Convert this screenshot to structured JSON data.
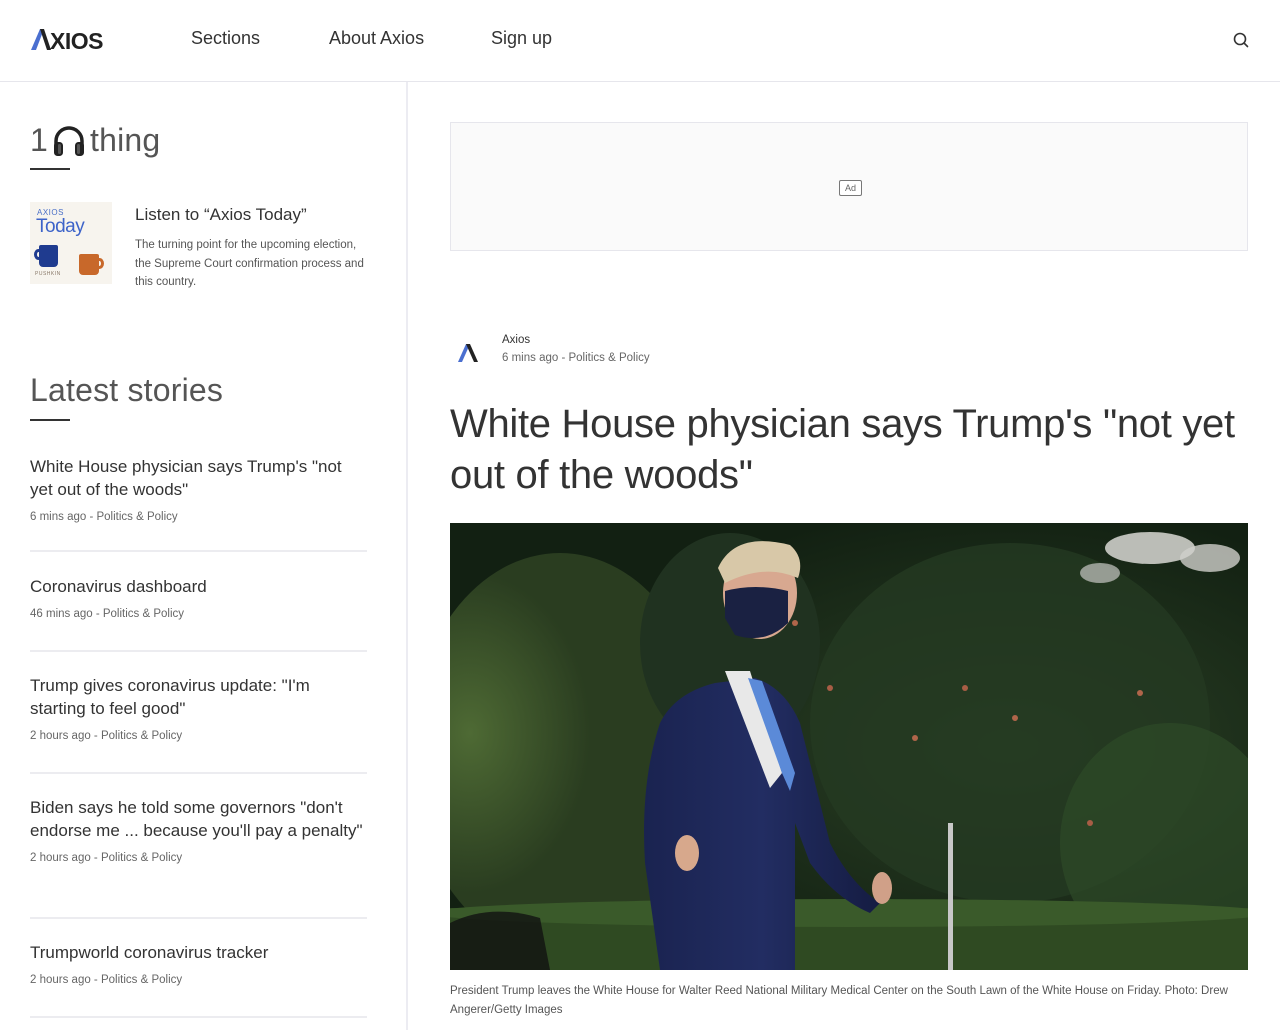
{
  "header": {
    "logo_text": "AXIOS",
    "nav": [
      {
        "label": "Sections"
      },
      {
        "label": "About Axios"
      },
      {
        "label": "Sign up"
      }
    ],
    "search_icon": "search-icon"
  },
  "sidebar": {
    "one_thing": {
      "title_prefix": "1",
      "title_icon": "headphones-icon",
      "title_suffix": "thing",
      "podcast": {
        "art_brand": "AXIOS",
        "art_title": "Today",
        "art_publisher": "PUSHKIN",
        "title": "Listen to “Axios Today”",
        "description": "The turning point for the upcoming election, the Supreme Court confirmation process and this country."
      }
    },
    "latest": {
      "title": "Latest stories",
      "stories": [
        {
          "title": "White House physician says Trump's \"not yet out of the woods\"",
          "meta": "6 mins ago - Politics & Policy"
        },
        {
          "title": "Coronavirus dashboard",
          "meta": "46 mins ago - Politics & Policy"
        },
        {
          "title": "Trump gives coronavirus update: \"I'm starting to feel good\"",
          "meta": "2 hours ago - Politics & Policy"
        },
        {
          "title": "Biden says he told some governors \"don't endorse me ... because you'll pay a penalty\"",
          "meta": "2 hours ago - Politics & Policy"
        },
        {
          "title": "Trumpworld coronavirus tracker",
          "meta": "2 hours ago - Politics & Policy"
        }
      ]
    }
  },
  "main": {
    "ad_label": "Ad",
    "article": {
      "author": "Axios",
      "meta": "6 mins ago - Politics & Policy",
      "headline": "White House physician says Trump's \"not yet out of the woods\"",
      "image_alt": "President Trump in a navy suit and face mask walking outdoors in front of green hedges",
      "caption": "President Trump leaves the White House for Walter Reed National Military Medical Center on the South Lawn of the White House on Friday. Photo: Drew Angerer/Getty Images"
    }
  },
  "colors": {
    "brand_blue": "#3d63c9",
    "text_dark": "#333333",
    "text_muted": "#666666",
    "divider": "#ececf0"
  }
}
